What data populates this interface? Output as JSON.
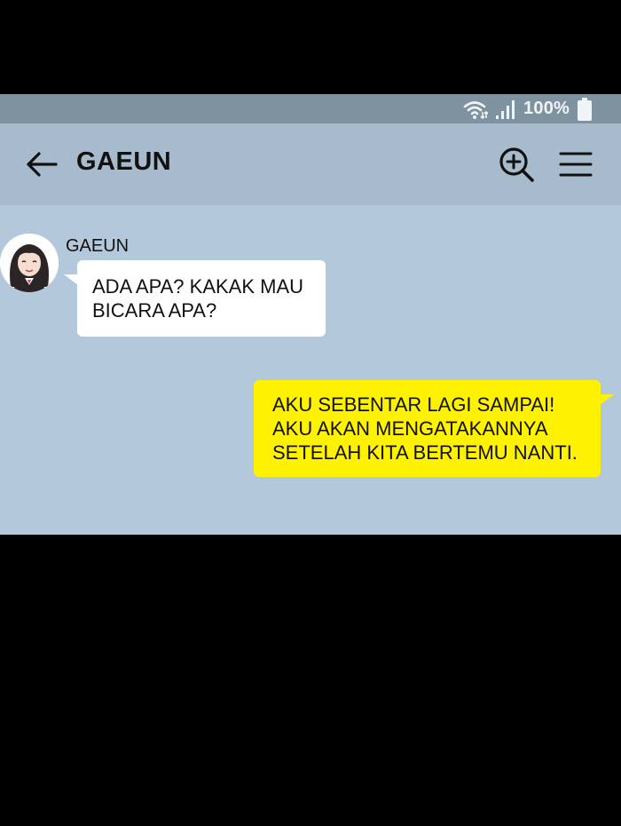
{
  "status_bar": {
    "battery_level": "100%",
    "icons": [
      "wifi-icon",
      "signal-icon",
      "battery-icon"
    ]
  },
  "header": {
    "title": "GAEUN",
    "icons": [
      "back-arrow-icon",
      "search-zoom-icon",
      "menu-icon"
    ]
  },
  "messages": [
    {
      "direction": "incoming",
      "sender": "GAEUN",
      "lines": [
        "ADA APA? KAKAK MAU",
        "BICARA APA?"
      ]
    },
    {
      "direction": "outgoing",
      "lines": [
        "AKU SEBENTAR LAGI SAMPAI!",
        "AKU AKAN MENGATAKANNYA",
        "SETELAH KITA BERTEMU NANTI."
      ]
    }
  ],
  "colors": {
    "background": "#000000",
    "status_bar": "#7f929f",
    "header": "#a8bbcd",
    "chat_area": "#b4c8dc",
    "incoming_bubble": "#ffffff",
    "outgoing_bubble": "#fff200"
  }
}
